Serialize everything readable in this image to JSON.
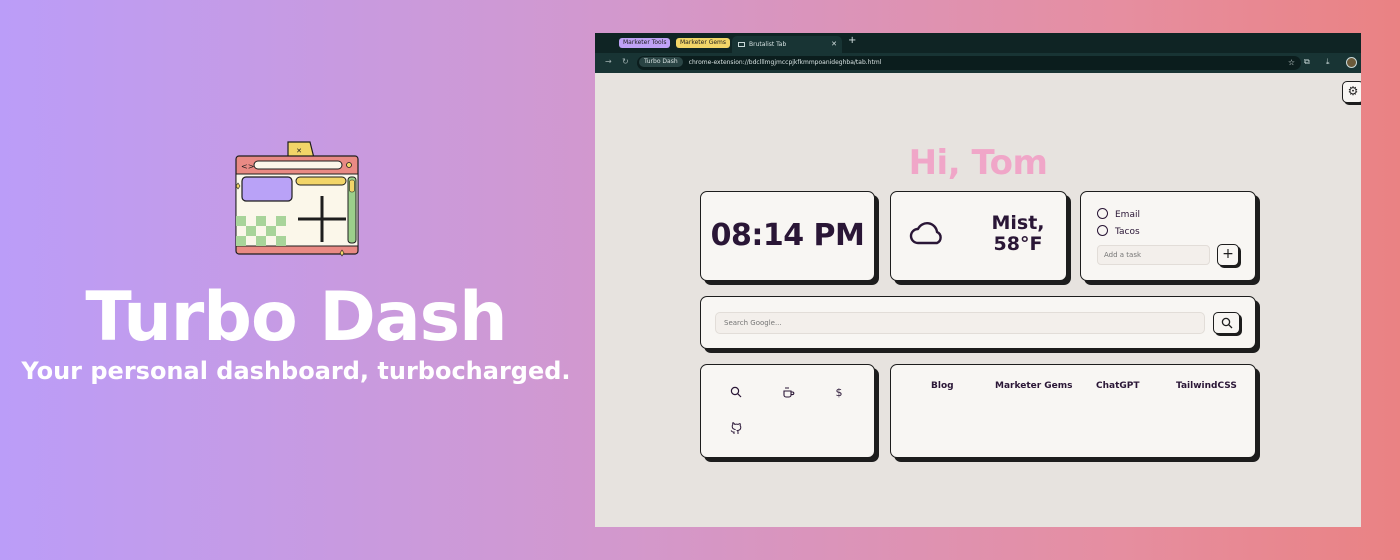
{
  "promo": {
    "title": "Turbo Dash",
    "tagline": "Your personal dashboard, turbocharged."
  },
  "browser": {
    "tabs": [
      {
        "label": "Marketer Tools",
        "color": "#bfa2f5"
      },
      {
        "label": "Marketer Gems",
        "color": "#f2d568"
      },
      {
        "label": "Brutalist Tab",
        "active": true
      }
    ],
    "site_chip": "Turbo Dash",
    "url": "chrome-extension://bdclllmgjmccpjkfkmmpoanideghba/tab.html"
  },
  "dashboard": {
    "greeting": "Hi, Tom",
    "clock": "08:14 PM",
    "weather": {
      "line1": "Mist,",
      "line2": "58°F",
      "icon": "cloud-icon"
    },
    "todos": [
      {
        "label": "Email",
        "done": false
      },
      {
        "label": "Tacos",
        "done": false
      }
    ],
    "todo_placeholder": "Add a task",
    "search_placeholder": "Search Google...",
    "shortcuts": [
      "search-icon",
      "coffee-icon",
      "dollar-icon",
      "github-icon"
    ],
    "links": [
      "Blog",
      "Marketer Gems",
      "ChatGPT",
      "TailwindCSS"
    ]
  },
  "colors": {
    "greeting": "#f0a6c8",
    "card_bg": "#f8f6f3",
    "page_bg": "#e7e3df",
    "ink": "#1d1d1d"
  }
}
